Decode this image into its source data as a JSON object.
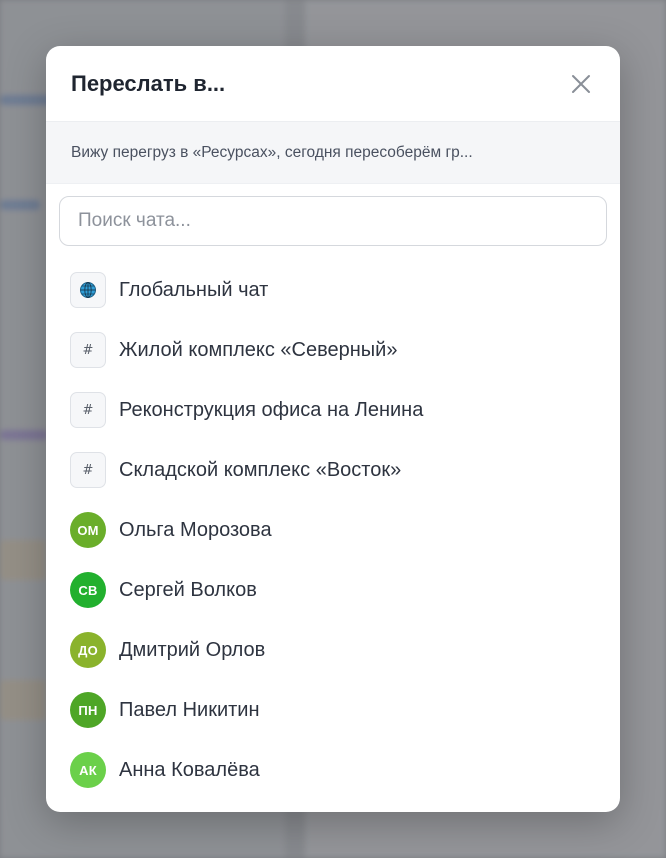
{
  "dialog": {
    "title": "Переслать в...",
    "preview_text": "Вижу перегруз в «Ресурсах», сегодня пересоберём гр...",
    "search": {
      "placeholder": "Поиск чата...",
      "value": ""
    },
    "chats": [
      {
        "name": "Глобальный чат",
        "type": "global",
        "icon": "globe-icon"
      },
      {
        "name": "Жилой комплекс «Северный»",
        "type": "channel",
        "icon": "#"
      },
      {
        "name": "Реконструкция офиса на Ленина",
        "type": "channel",
        "icon": "#"
      },
      {
        "name": "Складской комплекс «Восток»",
        "type": "channel",
        "icon": "#"
      },
      {
        "name": "Ольга Морозова",
        "type": "user",
        "initials": "ОМ",
        "color": "#6aae2a"
      },
      {
        "name": "Сергей Волков",
        "type": "user",
        "initials": "СВ",
        "color": "#22b02e"
      },
      {
        "name": "Дмитрий Орлов",
        "type": "user",
        "initials": "ДО",
        "color": "#8ab32c"
      },
      {
        "name": "Павел Никитин",
        "type": "user",
        "initials": "ПН",
        "color": "#4ea626"
      },
      {
        "name": "Анна Ковалёва",
        "type": "user",
        "initials": "АК",
        "color": "#6bd04a"
      }
    ]
  }
}
